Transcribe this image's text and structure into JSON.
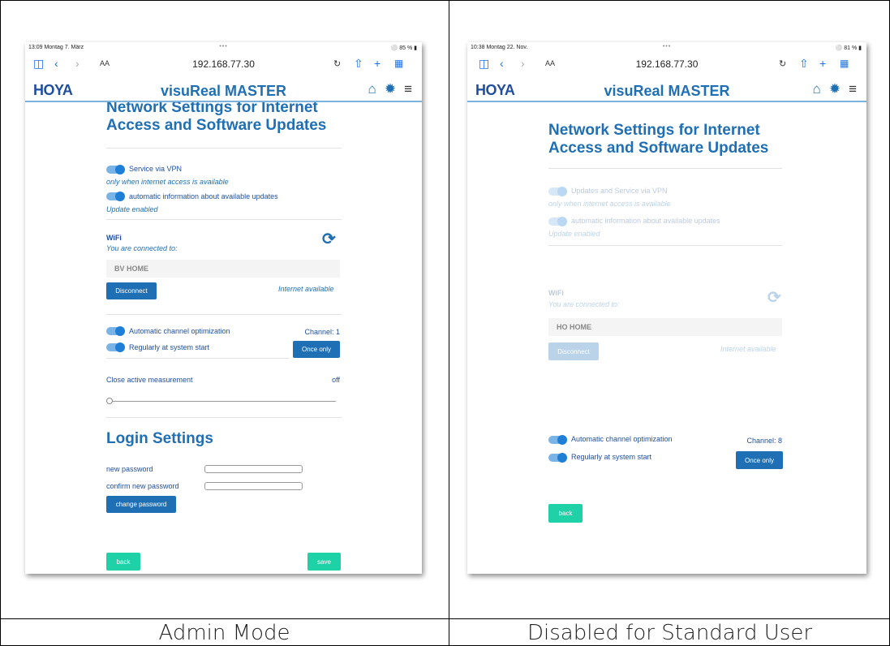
{
  "captions": {
    "left": "Admin Mode",
    "right": "Disabled for Standard User"
  },
  "left": {
    "status": {
      "time": "13:09  Montag 7. März",
      "dots": "•••",
      "battery": "85 %"
    },
    "browser": {
      "aa": "AA",
      "url": "192.168.77.30"
    },
    "app": {
      "logo": "HOYA",
      "title": "visuReal MASTER"
    },
    "network": {
      "title": "Network Settings for Internet Access and Software Updates",
      "vpn_label": "Service via VPN",
      "vpn_note": "only when internet access is available",
      "updates_label": "automatic information about available updates",
      "updates_note": "Update enabled",
      "wifi_label": "WiFi",
      "wifi_note": "You are connected to:",
      "wifi_name": "BV HOME",
      "disconnect": "Disconnect",
      "internet_status": "Internet available",
      "auto_channel_label": "Automatic channel optimization",
      "channel": "Channel: 1",
      "system_start_label": "Regularly at system start",
      "once_only": "Once only",
      "close_measurement": "Close active measurement",
      "close_state": "off",
      "slider_level": 0
    },
    "login": {
      "title": "Login Settings",
      "new_password": "new password",
      "confirm_password": "confirm new password",
      "change_password": "change password"
    },
    "back": "back",
    "save": "save"
  },
  "right": {
    "status": {
      "time": "10:38  Montag 22. Nov.",
      "dots": "•••",
      "battery": "81 %"
    },
    "browser": {
      "aa": "AA",
      "url": "192.168.77.30"
    },
    "app": {
      "logo": "HOYA",
      "title": "visuReal MASTER"
    },
    "network": {
      "title": "Network Settings for Internet Access and Software Updates",
      "vpn_label": "Updates and Service via VPN",
      "vpn_note": "only when internet access is available",
      "updates_label": "automatic information about available updates",
      "updates_note": "Update enabled",
      "wifi_label": "WiFi",
      "wifi_note": "You are connected to:",
      "wifi_name": "HO HOME",
      "disconnect": "Disconnect",
      "internet_status": "Internet available",
      "auto_channel_label": "Automatic channel optimization",
      "channel": "Channel: 8",
      "system_start_label": "Regularly at system start",
      "once_only": "Once only"
    },
    "back": "back"
  },
  "icons": {
    "sidebar": "sidebar-icon",
    "back": "chevron-left-icon",
    "forward": "chevron-right-icon",
    "reload": "reload-icon",
    "share": "share-icon",
    "add": "plus-icon",
    "tabs": "tabs-icon",
    "home": "home-icon",
    "globe": "globe-icon",
    "menu": "menu-icon",
    "refresh": "refresh-icon"
  },
  "colors": {
    "primary": "#1f6fb5",
    "green": "#1ed1a6",
    "toggle": "#1f7fd6"
  }
}
